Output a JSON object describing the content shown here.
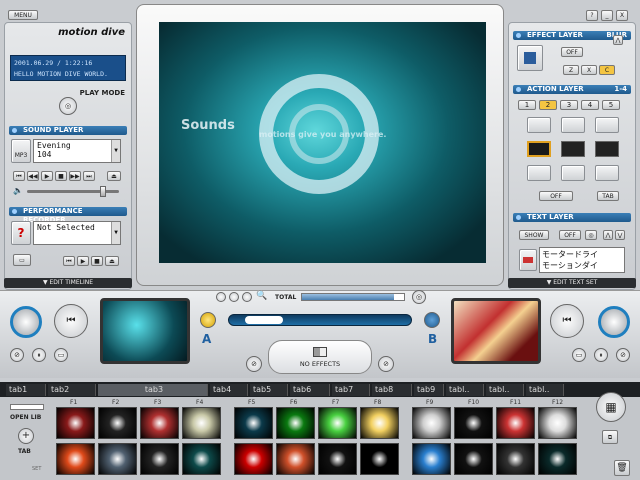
{
  "menu": {
    "label": "MENU"
  },
  "window_buttons": {
    "help": "?",
    "min": "_",
    "close": "X"
  },
  "brand": {
    "title": "motion dive"
  },
  "lcd": {
    "line1": "2001.06.29 / 1:22:16",
    "line2": "HELLO MOTION DIVE WORLD."
  },
  "play_mode": {
    "label": "PLAY MODE"
  },
  "sound_player": {
    "header": "SOUND PLAYER",
    "format": "MP3",
    "track_title": "Evening",
    "track_number": "104",
    "volume": 0.85
  },
  "recorder": {
    "header": "PERFORMANCE RECORDER",
    "status": "Not Selected",
    "help_glyph": "?"
  },
  "edit_timeline": {
    "label": "EDIT TIMELINE"
  },
  "screen": {
    "overlay_text_1": "Sounds",
    "overlay_text_2": "motions give you anywhere."
  },
  "effect_layer": {
    "header": "EFFECT LAYER",
    "type": "BLUR",
    "off_label": "OFF",
    "buttons": [
      "Z",
      "X",
      "C"
    ]
  },
  "action_layer": {
    "header": "ACTION LAYER",
    "range": "1-4",
    "tabs": [
      "1",
      "2",
      "3",
      "4",
      "5"
    ],
    "selected_tab": "2",
    "off_label": "OFF",
    "tab_label": "TAB"
  },
  "text_layer": {
    "header": "TEXT LAYER",
    "show_label": "SHOW",
    "off_label": "OFF",
    "text": "モータードライ\nモーションダイ"
  },
  "edit_text_set": {
    "label": "EDIT TEXT SET"
  },
  "mixer": {
    "total_label": "TOTAL",
    "total_value": 0.9,
    "crossfade": 0.1,
    "effects_label": "NO EFFECTS",
    "deck_a": "A",
    "deck_b": "B"
  },
  "tabs": [
    "tab1",
    "tab2",
    "tab3",
    "tab4",
    "tab5",
    "tab6",
    "tab7",
    "tab8",
    "tab9",
    "tabl..",
    "tabl..",
    "tabl.."
  ],
  "library": {
    "open_label": "OPEN LIB",
    "tab_label": "TAB",
    "set_label": "SET",
    "fkeys": [
      "F1",
      "F2",
      "F3",
      "F4",
      "F5",
      "F6",
      "F7",
      "F8",
      "F9",
      "F10",
      "F11",
      "F12"
    ],
    "thumb_colors_top": [
      "#8a1a1a",
      "#222",
      "#b03030",
      "#c9c9a8",
      "#0b3a4a",
      "#0a7a10",
      "#48d040",
      "#f2d060",
      "#cfcfcf",
      "#111",
      "#c33",
      "#ddd"
    ],
    "thumb_colors_bottom": [
      "#e04a1a",
      "#506070",
      "#222",
      "#0d4a4a",
      "#c00",
      "#d0502a",
      "#111",
      "#000",
      "#2a7fcf",
      "#111",
      "#333",
      "#0a2a2a"
    ]
  },
  "colors": {
    "accent": "#1f5a8d",
    "screen_teal": "#2aa9b5",
    "window_frame": "#c9ccd0"
  }
}
